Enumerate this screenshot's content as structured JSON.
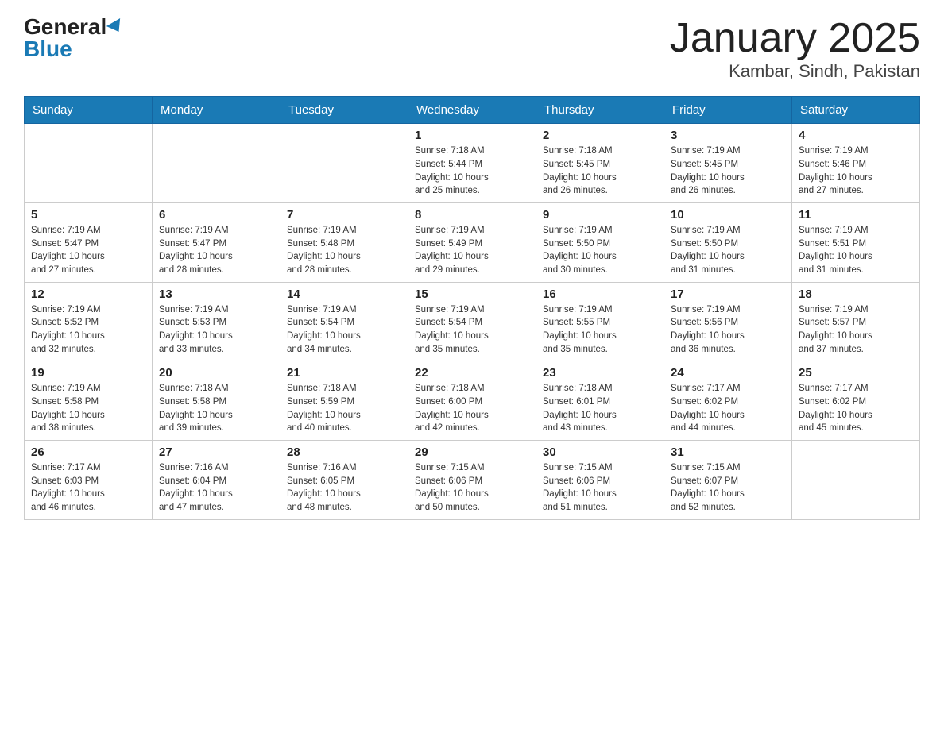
{
  "header": {
    "logo_general": "General",
    "logo_blue": "Blue",
    "title": "January 2025",
    "subtitle": "Kambar, Sindh, Pakistan"
  },
  "days_of_week": [
    "Sunday",
    "Monday",
    "Tuesday",
    "Wednesday",
    "Thursday",
    "Friday",
    "Saturday"
  ],
  "weeks": [
    [
      {
        "day": "",
        "info": ""
      },
      {
        "day": "",
        "info": ""
      },
      {
        "day": "",
        "info": ""
      },
      {
        "day": "1",
        "info": "Sunrise: 7:18 AM\nSunset: 5:44 PM\nDaylight: 10 hours\nand 25 minutes."
      },
      {
        "day": "2",
        "info": "Sunrise: 7:18 AM\nSunset: 5:45 PM\nDaylight: 10 hours\nand 26 minutes."
      },
      {
        "day": "3",
        "info": "Sunrise: 7:19 AM\nSunset: 5:45 PM\nDaylight: 10 hours\nand 26 minutes."
      },
      {
        "day": "4",
        "info": "Sunrise: 7:19 AM\nSunset: 5:46 PM\nDaylight: 10 hours\nand 27 minutes."
      }
    ],
    [
      {
        "day": "5",
        "info": "Sunrise: 7:19 AM\nSunset: 5:47 PM\nDaylight: 10 hours\nand 27 minutes."
      },
      {
        "day": "6",
        "info": "Sunrise: 7:19 AM\nSunset: 5:47 PM\nDaylight: 10 hours\nand 28 minutes."
      },
      {
        "day": "7",
        "info": "Sunrise: 7:19 AM\nSunset: 5:48 PM\nDaylight: 10 hours\nand 28 minutes."
      },
      {
        "day": "8",
        "info": "Sunrise: 7:19 AM\nSunset: 5:49 PM\nDaylight: 10 hours\nand 29 minutes."
      },
      {
        "day": "9",
        "info": "Sunrise: 7:19 AM\nSunset: 5:50 PM\nDaylight: 10 hours\nand 30 minutes."
      },
      {
        "day": "10",
        "info": "Sunrise: 7:19 AM\nSunset: 5:50 PM\nDaylight: 10 hours\nand 31 minutes."
      },
      {
        "day": "11",
        "info": "Sunrise: 7:19 AM\nSunset: 5:51 PM\nDaylight: 10 hours\nand 31 minutes."
      }
    ],
    [
      {
        "day": "12",
        "info": "Sunrise: 7:19 AM\nSunset: 5:52 PM\nDaylight: 10 hours\nand 32 minutes."
      },
      {
        "day": "13",
        "info": "Sunrise: 7:19 AM\nSunset: 5:53 PM\nDaylight: 10 hours\nand 33 minutes."
      },
      {
        "day": "14",
        "info": "Sunrise: 7:19 AM\nSunset: 5:54 PM\nDaylight: 10 hours\nand 34 minutes."
      },
      {
        "day": "15",
        "info": "Sunrise: 7:19 AM\nSunset: 5:54 PM\nDaylight: 10 hours\nand 35 minutes."
      },
      {
        "day": "16",
        "info": "Sunrise: 7:19 AM\nSunset: 5:55 PM\nDaylight: 10 hours\nand 35 minutes."
      },
      {
        "day": "17",
        "info": "Sunrise: 7:19 AM\nSunset: 5:56 PM\nDaylight: 10 hours\nand 36 minutes."
      },
      {
        "day": "18",
        "info": "Sunrise: 7:19 AM\nSunset: 5:57 PM\nDaylight: 10 hours\nand 37 minutes."
      }
    ],
    [
      {
        "day": "19",
        "info": "Sunrise: 7:19 AM\nSunset: 5:58 PM\nDaylight: 10 hours\nand 38 minutes."
      },
      {
        "day": "20",
        "info": "Sunrise: 7:18 AM\nSunset: 5:58 PM\nDaylight: 10 hours\nand 39 minutes."
      },
      {
        "day": "21",
        "info": "Sunrise: 7:18 AM\nSunset: 5:59 PM\nDaylight: 10 hours\nand 40 minutes."
      },
      {
        "day": "22",
        "info": "Sunrise: 7:18 AM\nSunset: 6:00 PM\nDaylight: 10 hours\nand 42 minutes."
      },
      {
        "day": "23",
        "info": "Sunrise: 7:18 AM\nSunset: 6:01 PM\nDaylight: 10 hours\nand 43 minutes."
      },
      {
        "day": "24",
        "info": "Sunrise: 7:17 AM\nSunset: 6:02 PM\nDaylight: 10 hours\nand 44 minutes."
      },
      {
        "day": "25",
        "info": "Sunrise: 7:17 AM\nSunset: 6:02 PM\nDaylight: 10 hours\nand 45 minutes."
      }
    ],
    [
      {
        "day": "26",
        "info": "Sunrise: 7:17 AM\nSunset: 6:03 PM\nDaylight: 10 hours\nand 46 minutes."
      },
      {
        "day": "27",
        "info": "Sunrise: 7:16 AM\nSunset: 6:04 PM\nDaylight: 10 hours\nand 47 minutes."
      },
      {
        "day": "28",
        "info": "Sunrise: 7:16 AM\nSunset: 6:05 PM\nDaylight: 10 hours\nand 48 minutes."
      },
      {
        "day": "29",
        "info": "Sunrise: 7:15 AM\nSunset: 6:06 PM\nDaylight: 10 hours\nand 50 minutes."
      },
      {
        "day": "30",
        "info": "Sunrise: 7:15 AM\nSunset: 6:06 PM\nDaylight: 10 hours\nand 51 minutes."
      },
      {
        "day": "31",
        "info": "Sunrise: 7:15 AM\nSunset: 6:07 PM\nDaylight: 10 hours\nand 52 minutes."
      },
      {
        "day": "",
        "info": ""
      }
    ]
  ]
}
